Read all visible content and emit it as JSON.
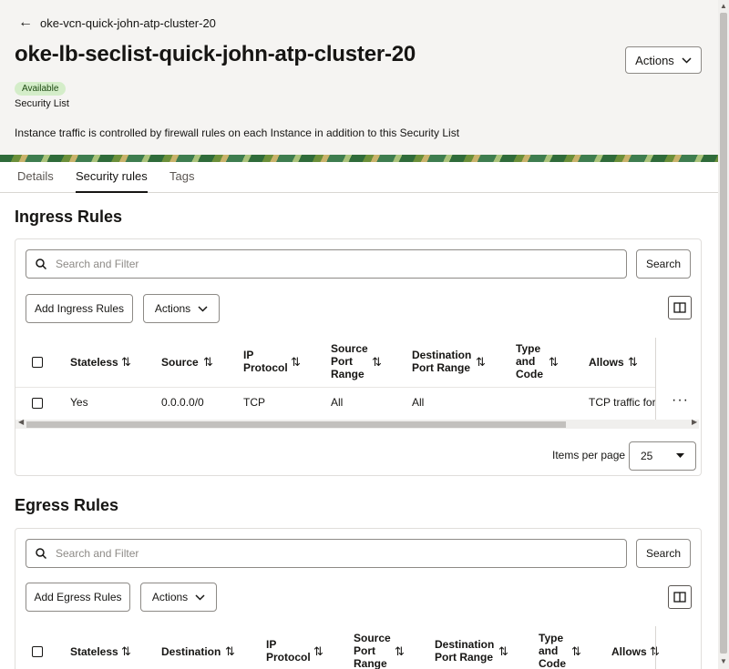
{
  "header": {
    "back_label": "oke-vcn-quick-john-atp-cluster-20",
    "title": "oke-lb-seclist-quick-john-atp-cluster-20",
    "actions_label": "Actions",
    "status_badge": "Available",
    "subtitle": "Security List",
    "description": "Instance traffic is controlled by firewall rules on each Instance in addition to this Security List"
  },
  "tabs": [
    {
      "label": "Details",
      "active": false
    },
    {
      "label": "Security rules",
      "active": true
    },
    {
      "label": "Tags",
      "active": false
    }
  ],
  "ingress": {
    "title": "Ingress Rules",
    "search_placeholder": "Search and Filter",
    "search_button": "Search",
    "add_button": "Add Ingress Rules",
    "actions_label": "Actions",
    "columns": [
      "Stateless",
      "Source",
      "IP Protocol",
      "Source Port Range",
      "Destination Port Range",
      "Type and Code",
      "Allows"
    ],
    "rows": [
      {
        "stateless": "Yes",
        "source": "0.0.0.0/0",
        "protocol": "TCP",
        "source_port": "All",
        "dest_port": "All",
        "type_code": "",
        "allows": "TCP traffic for p"
      }
    ],
    "items_per_page_label": "Items per page",
    "items_per_page": "25"
  },
  "egress": {
    "title": "Egress Rules",
    "search_placeholder": "Search and Filter",
    "search_button": "Search",
    "add_button": "Add Egress Rules",
    "actions_label": "Actions",
    "columns": [
      "Stateless",
      "Destination",
      "IP Protocol",
      "Source Port Range",
      "Destination Port Range",
      "Type and Code",
      "Allows"
    ]
  },
  "icons": {
    "back": "arrow-left-icon",
    "chevron": "chevron-down-icon",
    "search": "search-icon",
    "columns": "column-panel-icon",
    "sort": "sort-arrows-icon",
    "more": "more-options-icon"
  },
  "colors": {
    "header_bg": "#f5f4f2",
    "badge_bg": "#d4edc9",
    "text": "#161513"
  }
}
